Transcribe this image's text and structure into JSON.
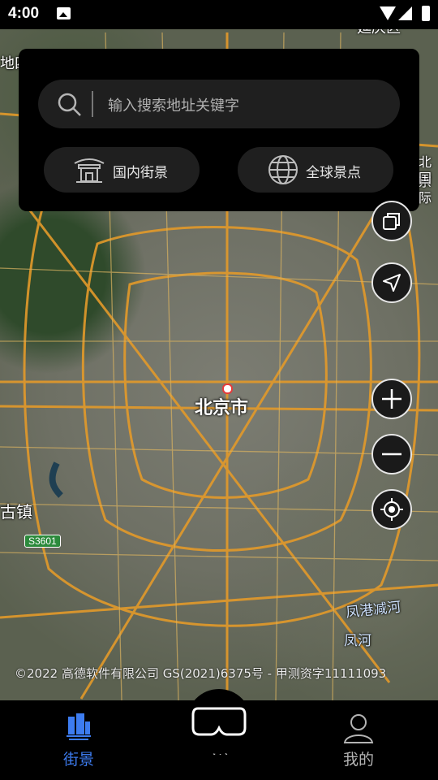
{
  "status_bar": {
    "time": "4:00"
  },
  "search": {
    "placeholder": "输入搜索地址关键字"
  },
  "quick_buttons": {
    "domestic": "国内街景",
    "global": "全球景点"
  },
  "map": {
    "city_label": "北京市",
    "labels": {
      "top_left": "地四",
      "top_right_1": "北京",
      "top_right_2": "国际",
      "left_town": "长辛店镇",
      "left_town_visible": "古镇",
      "road_sign": "S3601",
      "river_1": "凤港减河",
      "river_2": "凤河",
      "top_edge": "延庆区"
    },
    "copyright": "©2022 高德软件有限公司 GS(2021)6375号 - 甲测资字11111093"
  },
  "map_controls": [
    "layers-icon",
    "navigate-icon",
    "zoom-in-icon",
    "zoom-out-icon",
    "locate-icon"
  ],
  "tabbar": {
    "tab_street": "街景",
    "tab_vr": "VR",
    "tab_mine": "我的",
    "active_color": "#3d7cf0",
    "inactive_color": "#b4b4b4"
  }
}
